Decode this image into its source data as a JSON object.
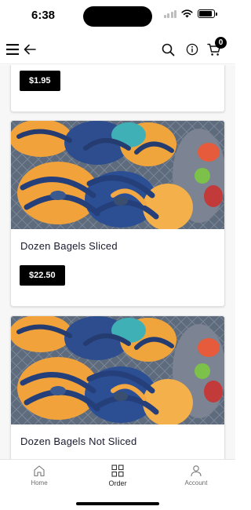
{
  "status_bar": {
    "time": "6:38",
    "battery_level": 0.9
  },
  "header": {
    "menu_icon": "hamburger-icon",
    "back_icon": "arrow-left-icon",
    "search_icon": "search-icon",
    "info_icon": "info-icon",
    "cart_icon": "cart-icon",
    "cart_count": "0"
  },
  "products": [
    {
      "price": "$1.95"
    },
    {
      "name": "Dozen Bagels Sliced",
      "price": "$22.50"
    },
    {
      "name": "Dozen Bagels Not Sliced"
    }
  ],
  "tabs": [
    {
      "label": "Home",
      "icon": "home-icon"
    },
    {
      "label": "Order",
      "icon": "grid-icon"
    },
    {
      "label": "Account",
      "icon": "user-icon"
    }
  ],
  "colors": {
    "primary": "#000000",
    "product_name": "#1a1a2e",
    "background": "#ffffff"
  }
}
